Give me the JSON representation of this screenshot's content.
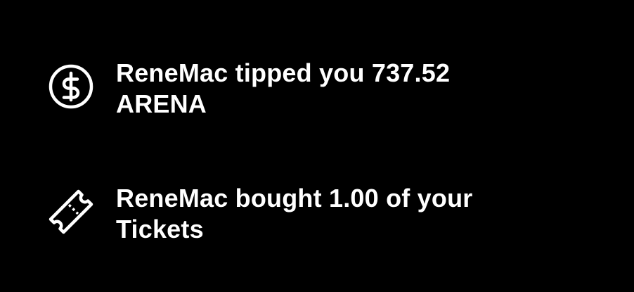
{
  "notifications": [
    {
      "icon": "dollar-circle-icon",
      "line1": "ReneMac tipped you 737.52",
      "line2": "ARENA"
    },
    {
      "icon": "ticket-icon",
      "line1": "ReneMac bought 1.00 of your",
      "line2": "Tickets"
    }
  ],
  "colors": {
    "background": "#000000",
    "foreground": "#ffffff"
  }
}
